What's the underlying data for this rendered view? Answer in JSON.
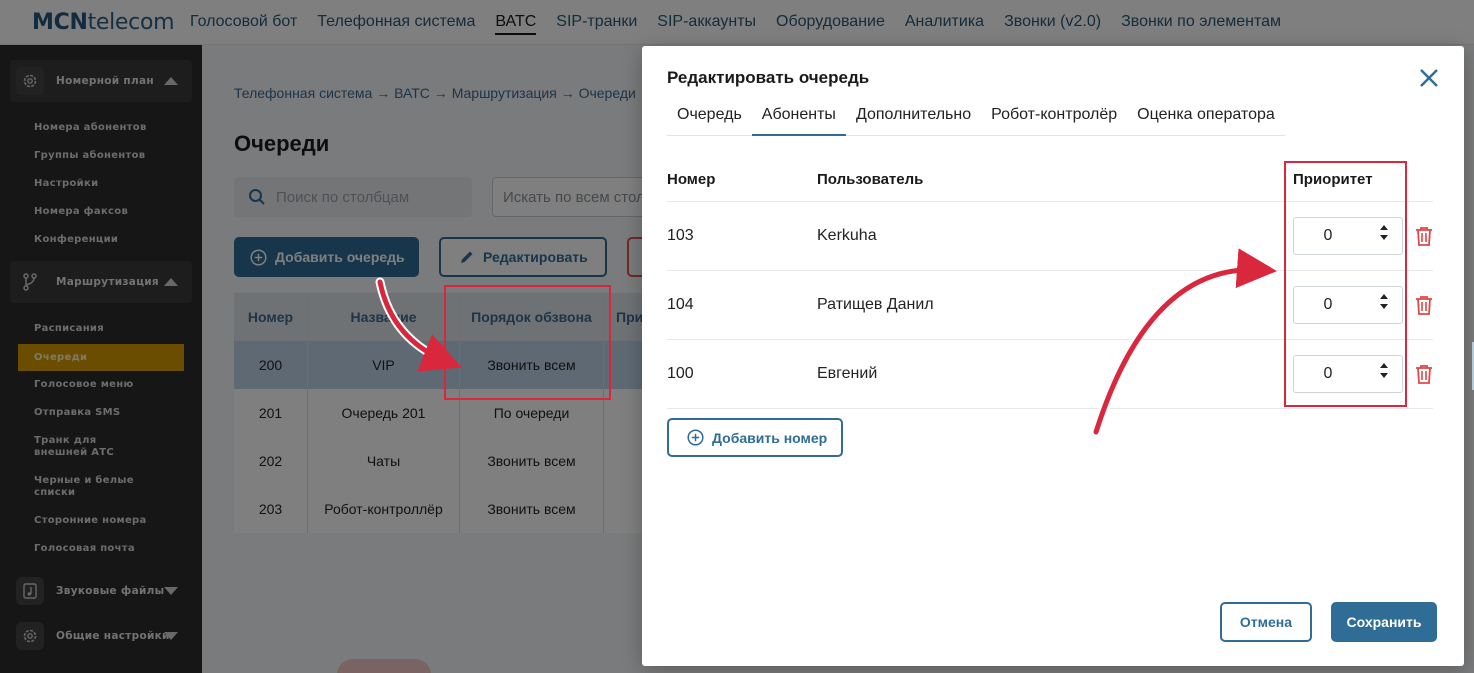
{
  "logo": {
    "bold": "MCN",
    "rest": "telecom"
  },
  "topnav": [
    {
      "label": "Голосовой бот"
    },
    {
      "label": "Телефонная система"
    },
    {
      "label": "ВАТС"
    },
    {
      "label": "SIP-транки"
    },
    {
      "label": "SIP-аккаунты"
    },
    {
      "label": "Оборудование"
    },
    {
      "label": "Аналитика"
    },
    {
      "label": "Звонки (v2.0)"
    },
    {
      "label": "Звонки по элементам"
    }
  ],
  "sidebar": {
    "groups": [
      {
        "label": "Номерной план",
        "icon": "gear-icon",
        "expanded": true
      },
      {
        "label": "Маршрутизация",
        "icon": "branch-icon",
        "expanded": true
      },
      {
        "label": "Звуковые файлы",
        "icon": "music-file-icon",
        "expanded": false
      },
      {
        "label": "Общие настройки",
        "icon": "gear-icon",
        "expanded": false
      }
    ],
    "numplan_items": [
      "Номера абонентов",
      "Группы абонентов",
      "Настройки",
      "Номера факсов",
      "Конференции"
    ],
    "routing_items": [
      "Расписания",
      "Очереди",
      "Голосовое меню",
      "Отправка SMS",
      "Транк для внешней АТС",
      "Черные и белые списки",
      "Сторонние номера",
      "Голосовая почта"
    ],
    "active_item": "Очереди"
  },
  "main": {
    "breadcrumbs": [
      "Телефонная система",
      "ВАТС",
      "Маршрутизация",
      "Очереди"
    ],
    "title": "Очереди",
    "search_columns_placeholder": "Поиск по столбцам",
    "search_all_placeholder": "Искать по всем столбцам",
    "add_queue_label": "Добавить очередь",
    "edit_label": "Редактировать",
    "table": {
      "headers": [
        "Номер",
        "Название",
        "Порядок обзвона",
        "При"
      ],
      "rows": [
        [
          "200",
          "VIP",
          "Звонить всем"
        ],
        [
          "201",
          "Очередь 201",
          "По очереди"
        ],
        [
          "202",
          "Чаты",
          "Звонить всем"
        ],
        [
          "203",
          "Робот-контроллёр",
          "Звонить всем"
        ]
      ]
    }
  },
  "modal": {
    "title": "Редактировать очередь",
    "tabs": [
      "Очередь",
      "Абоненты",
      "Дополнительно",
      "Робот-контролёр",
      "Оценка оператора"
    ],
    "active_tab": "Абоненты",
    "headers": {
      "number": "Номер",
      "user": "Пользователь",
      "priority": "Приоритет"
    },
    "rows": [
      {
        "number": "103",
        "user": "Kerkuha",
        "priority": "0"
      },
      {
        "number": "104",
        "user": "Ратищев Данил",
        "priority": "0"
      },
      {
        "number": "100",
        "user": "Евгений",
        "priority": "0"
      }
    ],
    "add_number_label": "Добавить номер",
    "cancel_label": "Отмена",
    "save_label": "Сохранить"
  },
  "colors": {
    "accent": "#2f6d96",
    "highlight": "#d9283d",
    "sidebar_active": "#d79a00"
  }
}
